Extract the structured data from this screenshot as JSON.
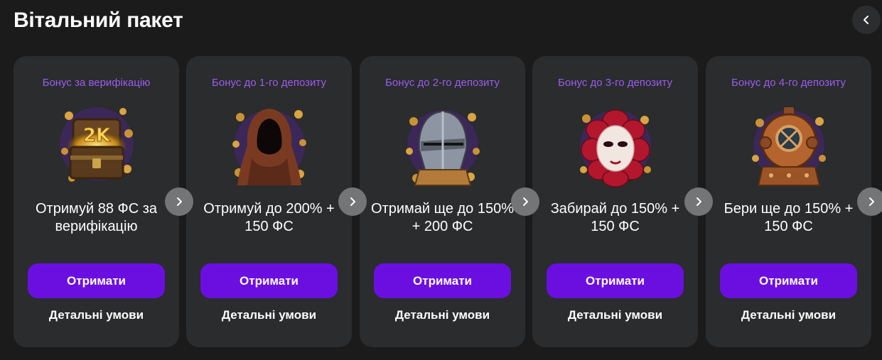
{
  "section": {
    "title": "Вітальний пакет",
    "prev_icon": "chevron-left-icon"
  },
  "colors": {
    "background": "#1b1b1c",
    "card": "#2a2c2d",
    "label": "#9b5cf0",
    "button": "#6b0fe0",
    "nav_button": "#737577"
  },
  "cards": [
    {
      "label": "Бонус за верифікацію",
      "image": "treasure-chest-2k",
      "text": "Отримуй 88 ФС за верифікацію",
      "button": "Отримати",
      "details": "Детальні умови",
      "next_icon": "chevron-right-icon"
    },
    {
      "label": "Бонус до 1-го депозиту",
      "image": "hooded-figure",
      "text": "Отримуй до 200% + 150 ФС",
      "button": "Отримати",
      "details": "Детальні умови",
      "next_icon": "chevron-right-icon"
    },
    {
      "label": "Бонус до 2-го депозиту",
      "image": "knight-helmet",
      "text": "Отримай ще до 150% + 200 ФС",
      "button": "Отримати",
      "details": "Детальні умови",
      "next_icon": "chevron-right-icon"
    },
    {
      "label": "Бонус до 3-го депозиту",
      "image": "venetian-mask",
      "text": "Забирай до 150% + 150 ФС",
      "button": "Отримати",
      "details": "Детальні умови",
      "next_icon": "chevron-right-icon"
    },
    {
      "label": "Бонус до 4-го депозиту",
      "image": "diving-helmet",
      "text": "Бери ще до 150% + 150 ФС",
      "button": "Отримати",
      "details": "Детальні умови",
      "next_icon": "chevron-right-icon"
    }
  ]
}
